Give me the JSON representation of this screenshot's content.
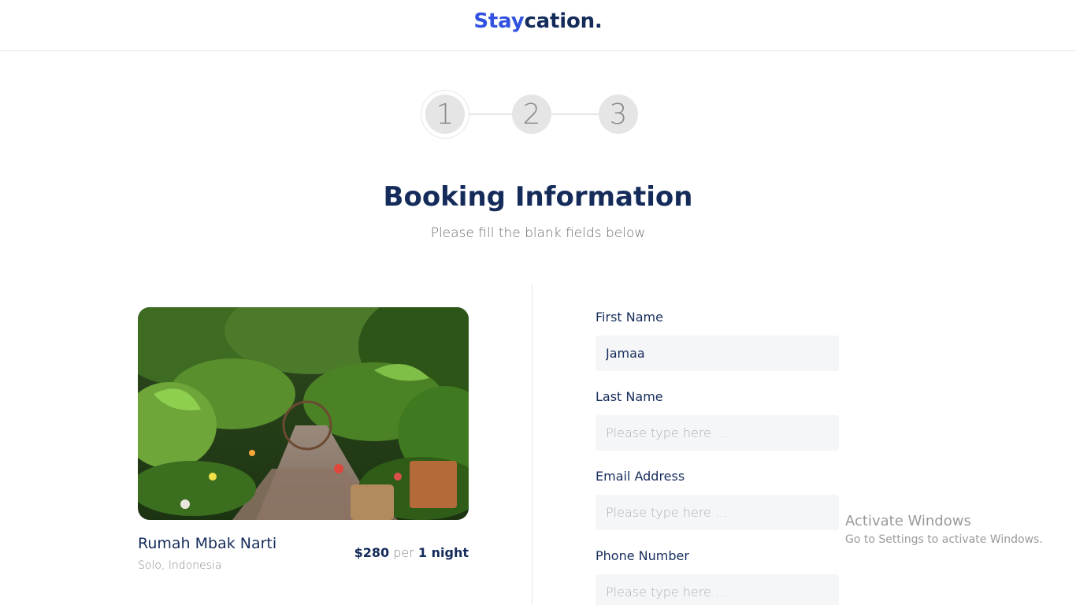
{
  "header": {
    "brand_accent": "Stay",
    "brand_rest": "cation."
  },
  "stepper": {
    "steps": [
      "1",
      "2",
      "3"
    ],
    "active_step": 1
  },
  "page": {
    "title": "Booking Information",
    "subtitle": "Please fill the blank fields below"
  },
  "property": {
    "name": "Rumah Mbak Narti",
    "location": "Solo, Indonesia",
    "price_amount": "$280",
    "price_per": "per",
    "price_unit": "1 night"
  },
  "form": {
    "first_name_label": "First Name",
    "first_name_value": "Jamaa",
    "last_name_label": "Last Name",
    "email_label": "Email Address",
    "phone_label": "Phone Number",
    "placeholder": "Please type here ..."
  },
  "watermark": {
    "line1": "Activate Windows",
    "line2": "Go to Settings to activate Windows."
  },
  "colors": {
    "accent": "#3252DF",
    "primary_text": "#152C5B",
    "muted_text": "#898989",
    "input_bg": "#F5F6F8",
    "border": "#E5E5E5"
  }
}
